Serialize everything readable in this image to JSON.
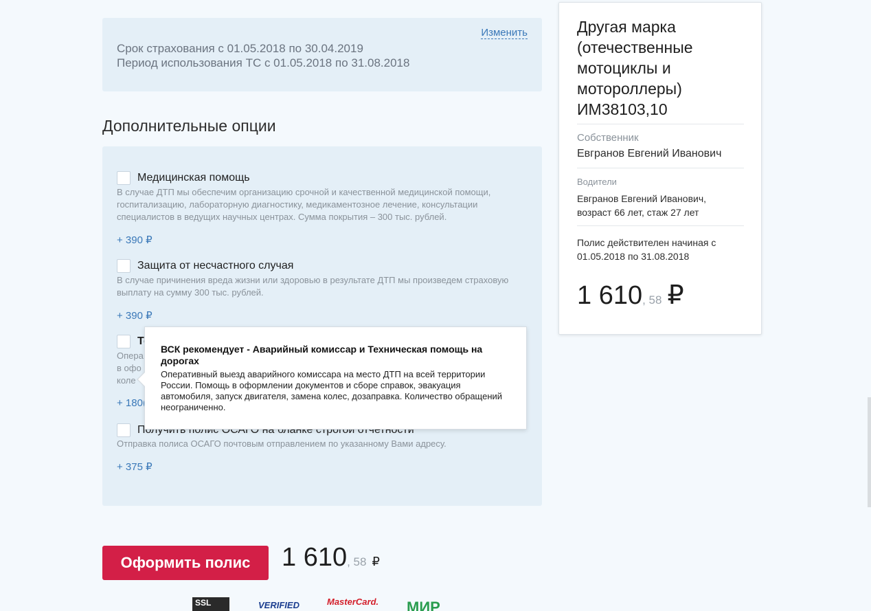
{
  "period": {
    "change_link": "Изменить",
    "insurance_term": "Срок страхования с 01.05.2018 по 30.04.2019",
    "usage_period": "Период использования ТС  с 01.05.2018 по 31.08.2018"
  },
  "options_section": {
    "title": "Дополнительные опции",
    "items": [
      {
        "title": "Медицинская помощь",
        "description": "В случае ДТП мы обеспечим организацию срочной и качественной медицинской помощи, госпитализацию, лабораторную диагностику, медикаментозное лечение, консультации специалистов в ведущих научных центрах. Сумма покрытия – 300 тыс. рублей.",
        "price": "+ 390 ₽",
        "checked": false
      },
      {
        "title": "Защита от несчастного случая",
        "description": "В случае причинения вреда жизни или здоровью в результате ДТП мы произведем страховую выплату на сумму 300 тыс. рублей.",
        "price": "+ 390 ₽",
        "checked": false
      },
      {
        "title": "Те",
        "description": "Опера в офо коле",
        "price": "+ 180(",
        "checked": false
      },
      {
        "title": "Получить полис ОСАГО на бланке строгой отчетности",
        "description": "Отправка полиса ОСАГО почтовым отправлением по указанному Вами адресу.",
        "price": "+ 375 ₽",
        "checked": false
      }
    ]
  },
  "tooltip": {
    "title": "ВСК рекомендует - Аварийный комиссар и Техническая помощь на дорогах",
    "body": "Оперативный выезд аварийного комиссара на место ДТП на всей территории России. Помощь в оформлении документов и сборе справок, эвакуация автомобиля, запуск двигателя, замена колес, дозаправка. Количество обращений неограниченно."
  },
  "checkout": {
    "button_label": "Оформить полис",
    "price_main": "1 610",
    "price_kopecks": ", 58",
    "currency": "₽"
  },
  "payment_logos": [
    "SSL",
    "VERIFIED",
    "MasterCard.",
    "МИР"
  ],
  "summary": {
    "vehicle": "Другая марка (отечественные мотоциклы и мотороллеры) ИМ38103,10",
    "owner_label": "Собственник",
    "owner_value": "Евгранов Евгений Иванович",
    "drivers_label": "Водители",
    "drivers_value": "Евгранов Евгений Иванович, возраст 66 лет, стаж 27 лет",
    "validity": "Полис действителен начиная с 01.05.2018 по 31.08.2018",
    "price_main": "1 610",
    "price_kopecks": ", 58",
    "currency": "₽"
  },
  "colors": {
    "accent_button": "#d31f47",
    "link": "#3a78b8",
    "card_bg": "#e4eff7",
    "page_bg": "#f4f9fd"
  }
}
